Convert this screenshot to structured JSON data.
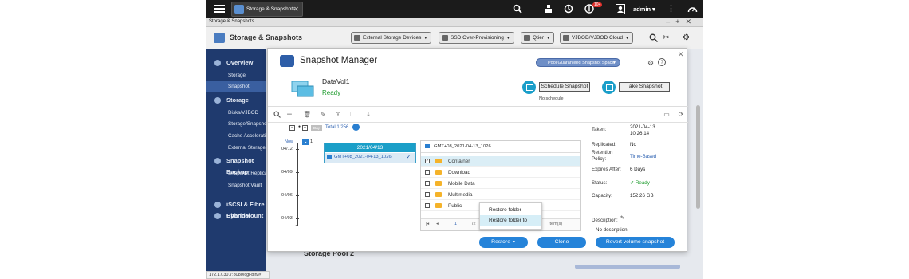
{
  "topbar": {
    "app_tab_label": "Storage & Snapshots",
    "notification_count": "10+",
    "username": "admin"
  },
  "app": {
    "titlebar": "Storage & Snapshots",
    "title": "Storage & Snapshots",
    "toolbar": [
      "External Storage Devices",
      "SSD Over-Provisioning",
      "Qtier",
      "VJBOD/VJBOD Cloud"
    ]
  },
  "sidebar": {
    "overview": "Overview",
    "overview_items": [
      "Storage",
      "Snapshot"
    ],
    "storage": "Storage",
    "storage_items": [
      "Disks/VJBOD",
      "Storage/Snapshots",
      "Cache Acceleration",
      "External Storage"
    ],
    "backup": "Snapshot Backup",
    "backup_items": [
      "Snapshot Replica",
      "Snapshot Vault"
    ],
    "iscsi": "iSCSI & Fibre Channel",
    "hybrid": "HybridMount"
  },
  "background": {
    "pool_title": "Storage Pool 2",
    "status_url": "172.17.30.7:8080/cgi-bin/#"
  },
  "modal": {
    "title": "Snapshot Manager",
    "guaranteed_space": "Pool Guaranteed Snapshot Space",
    "volume_name": "DataVol1",
    "volume_status": "Ready",
    "schedule_button": "Schedule Snapshot",
    "schedule_status": "No schedule",
    "take_button": "Take Snapshot",
    "day_badge": "Day",
    "total": "Total 1/256",
    "timeline": {
      "now_label": "Now",
      "now_count": "1",
      "dates": [
        "04/12",
        "04/09",
        "04/06",
        "04/03"
      ]
    },
    "snapshot_card": {
      "date": "2021/04/13",
      "name": "GMT+08_2021-04-13_1026"
    },
    "files": {
      "header": "GMT+08_2021-04-13_1026",
      "rows": [
        {
          "name": "Container",
          "checked": true
        },
        {
          "name": "Download",
          "checked": false
        },
        {
          "name": "Mobile Data",
          "checked": false
        },
        {
          "name": "Multimedia",
          "checked": false
        },
        {
          "name": "Public",
          "checked": false
        }
      ],
      "pager_page": "1",
      "pager_total": "/2",
      "pager_items": "Item(s)"
    },
    "context_menu": [
      "Restore folder",
      "Restore folder to"
    ],
    "details": {
      "taken_label": "Taken:",
      "taken_value": "2021-04-13",
      "taken_time": "10:26:14",
      "replicated_label": "Replicated:",
      "replicated_value": "No",
      "retention_label": "Retention",
      "retention_label2": "Policy:",
      "retention_value": "Time-Based",
      "expires_label": "Expires After:",
      "expires_value": "6 Days",
      "status_label": "Status:",
      "status_value": "Ready",
      "capacity_label": "Capacity:",
      "capacity_value": "152.26 GB",
      "description_label": "Description:",
      "description_value": "No description"
    },
    "footer": {
      "restore": "Restore",
      "clone": "Clone",
      "revert": "Revert volume snapshot"
    }
  }
}
